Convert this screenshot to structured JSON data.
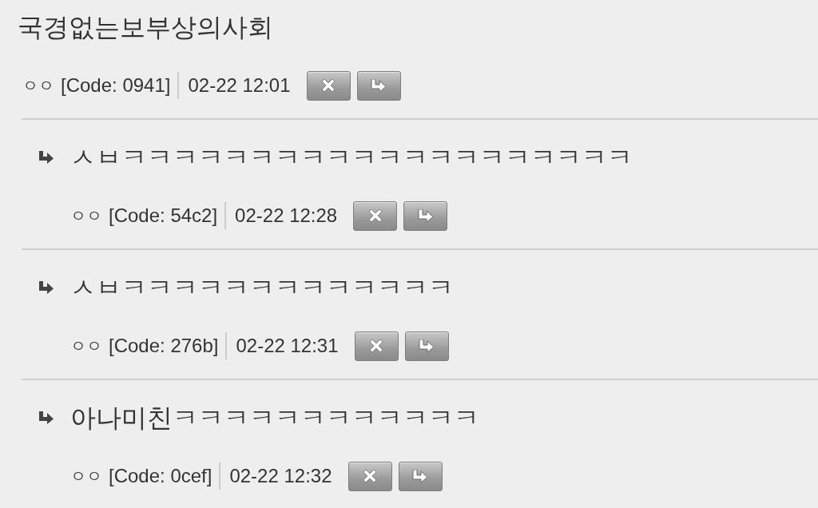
{
  "post": {
    "title": "국경없는보부상의사회",
    "author": "ㅇㅇ",
    "code": "[Code: 0941]",
    "time": "02-22 12:01"
  },
  "replies": [
    {
      "text": "ㅅㅂㅋㅋㅋㅋㅋㅋㅋㅋㅋㅋㅋㅋㅋㅋㅋㅋㅋㅋㅋㅋ",
      "author": "ㅇㅇ",
      "code": "[Code: 54c2]",
      "time": "02-22 12:28"
    },
    {
      "text": "ㅅㅂㅋㅋㅋㅋㅋㅋㅋㅋㅋㅋㅋㅋㅋ",
      "author": "ㅇㅇ",
      "code": "[Code: 276b]",
      "time": "02-22 12:31"
    },
    {
      "text": "아나미친ㅋㅋㅋㅋㅋㅋㅋㅋㅋㅋㅋㅋ",
      "author": "ㅇㅇ",
      "code": "[Code: 0cef]",
      "time": "02-22 12:32"
    }
  ]
}
